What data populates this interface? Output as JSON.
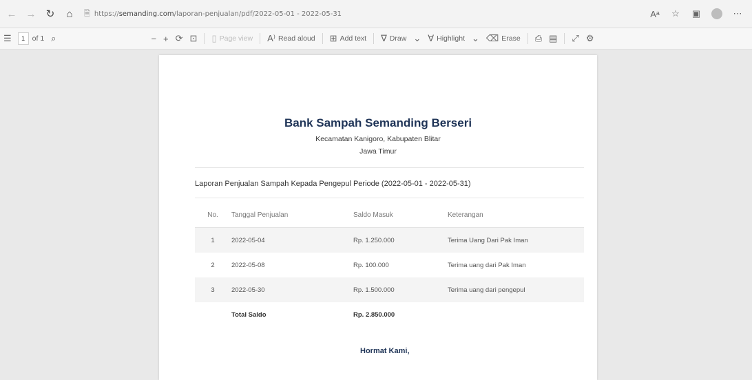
{
  "browser": {
    "url_prefix": "https://",
    "url_host": "semanding.com",
    "url_path": "/laporan-penjualan/pdf/2022-05-01 - 2022-05-31"
  },
  "pdf_toolbar": {
    "page_current": "1",
    "page_total": "of 1",
    "page_view": "Page view",
    "read_aloud": "Read aloud",
    "add_text": "Add text",
    "draw": "Draw",
    "highlight": "Highlight",
    "erase": "Erase"
  },
  "document": {
    "title": "Bank Sampah Semanding Berseri",
    "subtitle_line1": "Kecamatan Kanigoro, Kabupaten Blitar",
    "subtitle_line2": "Jawa Timur",
    "report_title": "Laporan Penjualan Sampah Kepada Pengepul Periode (2022-05-01 - 2022-05-31)",
    "table": {
      "headers": [
        "No.",
        "Tanggal Penjualan",
        "Saldo Masuk",
        "Keterangan"
      ],
      "rows": [
        {
          "no": "1",
          "date": "2022-05-04",
          "amount": "Rp. 1.250.000",
          "note": "Terima Uang Dari Pak Iman"
        },
        {
          "no": "2",
          "date": "2022-05-08",
          "amount": "Rp. 100.000",
          "note": "Terima uang dari Pak Iman"
        },
        {
          "no": "3",
          "date": "2022-05-30",
          "amount": "Rp. 1.500.000",
          "note": "Terima uang dari pengepul"
        }
      ],
      "total_label": "Total Saldo",
      "total_value": "Rp. 2.850.000"
    },
    "closing": "Hormat Kami,"
  }
}
